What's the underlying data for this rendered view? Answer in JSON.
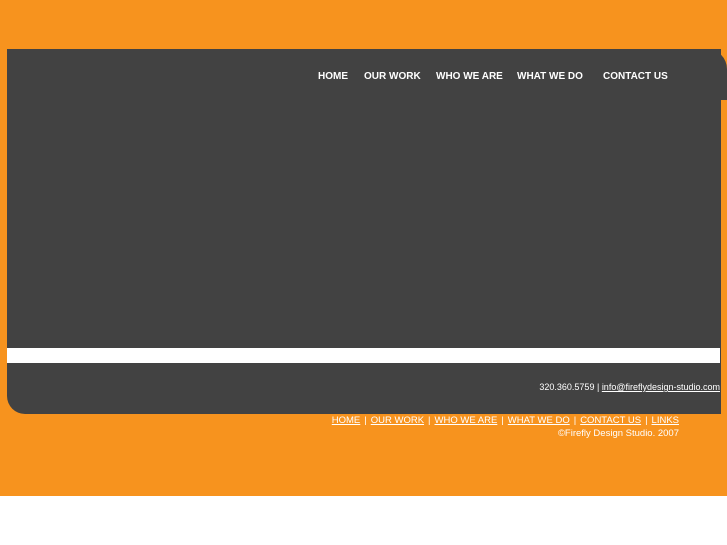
{
  "nav": {
    "home": "HOME",
    "our_work": "OUR WORK",
    "who_we_are": "WHO WE ARE",
    "what_we_do": "WHAT WE DO",
    "contact_us": "CONTACT US"
  },
  "contact": {
    "phone": "320.360.5759 |",
    "email": "info@fireflydesign-studio.com"
  },
  "footer": {
    "links": {
      "home": "HOME",
      "our_work": "OUR WORK",
      "who_we_are": "WHO WE ARE",
      "what_we_do": "WHAT WE DO",
      "contact_us": "CONTACT US",
      "links": "LINKS"
    },
    "separator": "|",
    "copyright": "©Firefly Design Studio. 2007"
  },
  "colors": {
    "background": "#f7931e",
    "panel": "#424242",
    "text": "#ffffff"
  }
}
